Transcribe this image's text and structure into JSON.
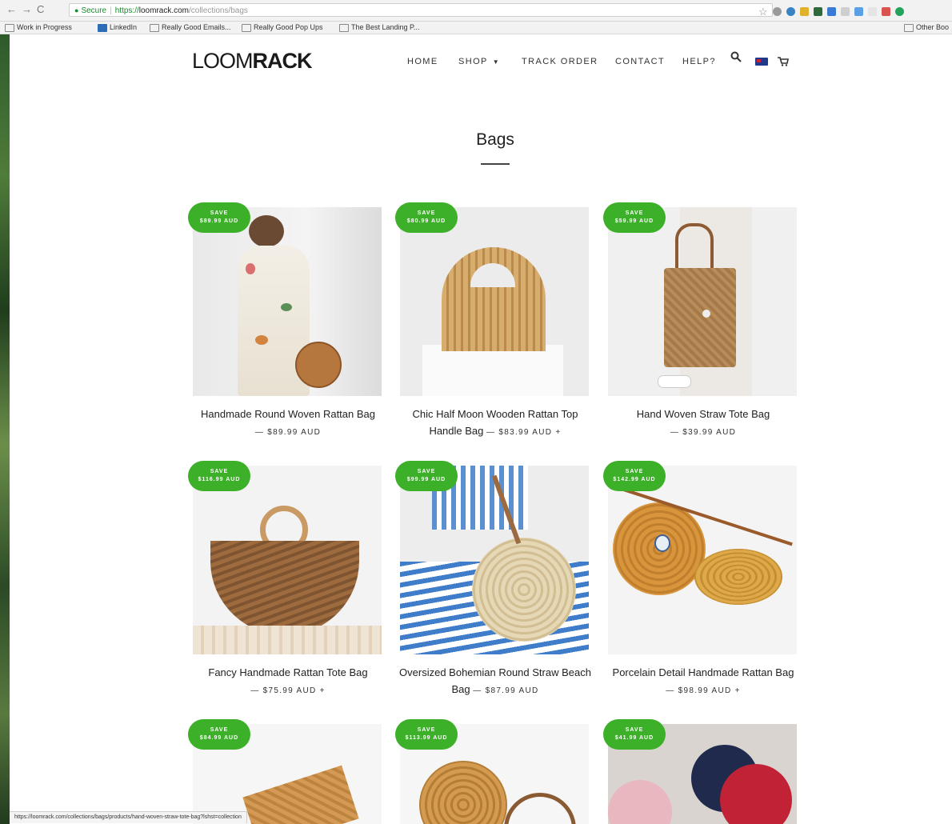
{
  "browser": {
    "secure_label": "Secure",
    "url_proto": "https://",
    "url_host": "loomrack.com",
    "url_path": "/collections/bags",
    "bookmarks": [
      "Work in Progress",
      "LinkedIn",
      "Really Good Emails...",
      "Really Good Pop Ups",
      "The Best Landing P..."
    ],
    "bookmark_other": "Other Boo",
    "status_url": "https://loomrack.com/collections/bags/products/hand-woven-straw-tote-bag?lshst=collection"
  },
  "header": {
    "logo_thin": "LOOM",
    "logo_bold": "RACK",
    "nav": [
      "HOME",
      "SHOP",
      "TRACK ORDER",
      "CONTACT",
      "HELP?"
    ]
  },
  "page": {
    "title": "Bags"
  },
  "products": [
    {
      "badge_label": "SAVE",
      "badge_amount": "$89.99 AUD",
      "name": "Handmade Round Woven Rattan Bag",
      "price": "— $89.99 AUD",
      "has_options": false
    },
    {
      "badge_label": "SAVE",
      "badge_amount": "$80.99 AUD",
      "name": "Chic Half Moon Wooden Rattan Top Handle Bag",
      "price": "— $83.99 AUD +",
      "has_options": true
    },
    {
      "badge_label": "SAVE",
      "badge_amount": "$59.99 AUD",
      "name": "Hand Woven Straw Tote Bag",
      "price": "— $39.99 AUD",
      "has_options": false
    },
    {
      "badge_label": "SAVE",
      "badge_amount": "$116.99 AUD",
      "name": "Fancy Handmade Rattan Tote Bag",
      "price": "— $75.99 AUD +",
      "has_options": true
    },
    {
      "badge_label": "SAVE",
      "badge_amount": "$99.99 AUD",
      "name": "Oversized Bohemian Round Straw Beach Bag",
      "price": "— $87.99 AUD",
      "has_options": false
    },
    {
      "badge_label": "SAVE",
      "badge_amount": "$142.99 AUD",
      "name": "Porcelain Detail Handmade Rattan Bag",
      "price": "— $98.99 AUD +",
      "has_options": true
    },
    {
      "badge_label": "SAVE",
      "badge_amount": "$84.99 AUD",
      "name": "",
      "price": "",
      "has_options": false
    },
    {
      "badge_label": "SAVE",
      "badge_amount": "$113.99 AUD",
      "name": "",
      "price": "",
      "has_options": false
    },
    {
      "badge_label": "SAVE",
      "badge_amount": "$41.99 AUD",
      "name": "",
      "price": "",
      "has_options": false
    }
  ],
  "colors": {
    "badge": "#3cb028",
    "text": "#222222"
  }
}
